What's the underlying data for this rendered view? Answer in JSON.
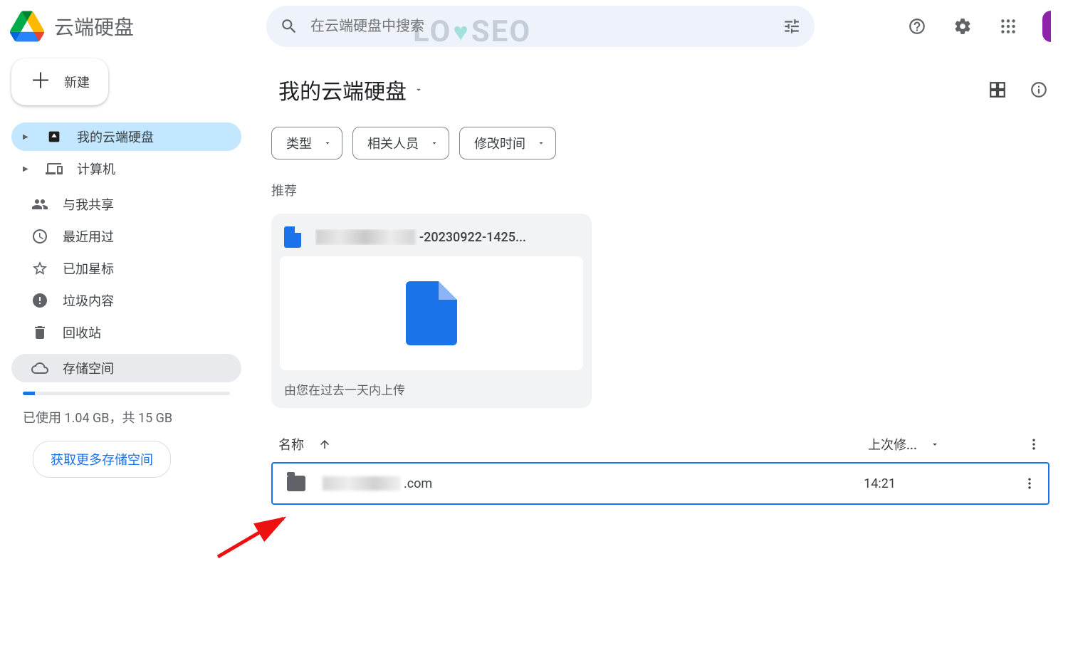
{
  "app": {
    "name": "云端硬盘"
  },
  "watermark": {
    "lo": "LO",
    "seo": "SEO"
  },
  "search": {
    "placeholder": "在云端硬盘中搜索"
  },
  "new_button": {
    "label": "新建"
  },
  "sidebar": {
    "items": [
      {
        "label": "我的云端硬盘"
      },
      {
        "label": "计算机"
      },
      {
        "label": "与我共享"
      },
      {
        "label": "最近用过"
      },
      {
        "label": "已加星标"
      },
      {
        "label": "垃圾内容"
      },
      {
        "label": "回收站"
      },
      {
        "label": "存储空间"
      }
    ],
    "storage_text": "已使用 1.04 GB，共 15 GB",
    "get_more": "获取更多存储空间"
  },
  "main": {
    "title": "我的云端硬盘",
    "chips": {
      "type": "类型",
      "people": "相关人员",
      "modified": "修改时间"
    },
    "recommended_label": "推荐",
    "recommended_card": {
      "filename_suffix": "-20230922-1425...",
      "subtext": "由您在过去一天内上传"
    },
    "list": {
      "col_name": "名称",
      "col_last": "上次修..."
    },
    "rows": [
      {
        "name_suffix": ".com",
        "last_modified": "14:21"
      }
    ]
  }
}
